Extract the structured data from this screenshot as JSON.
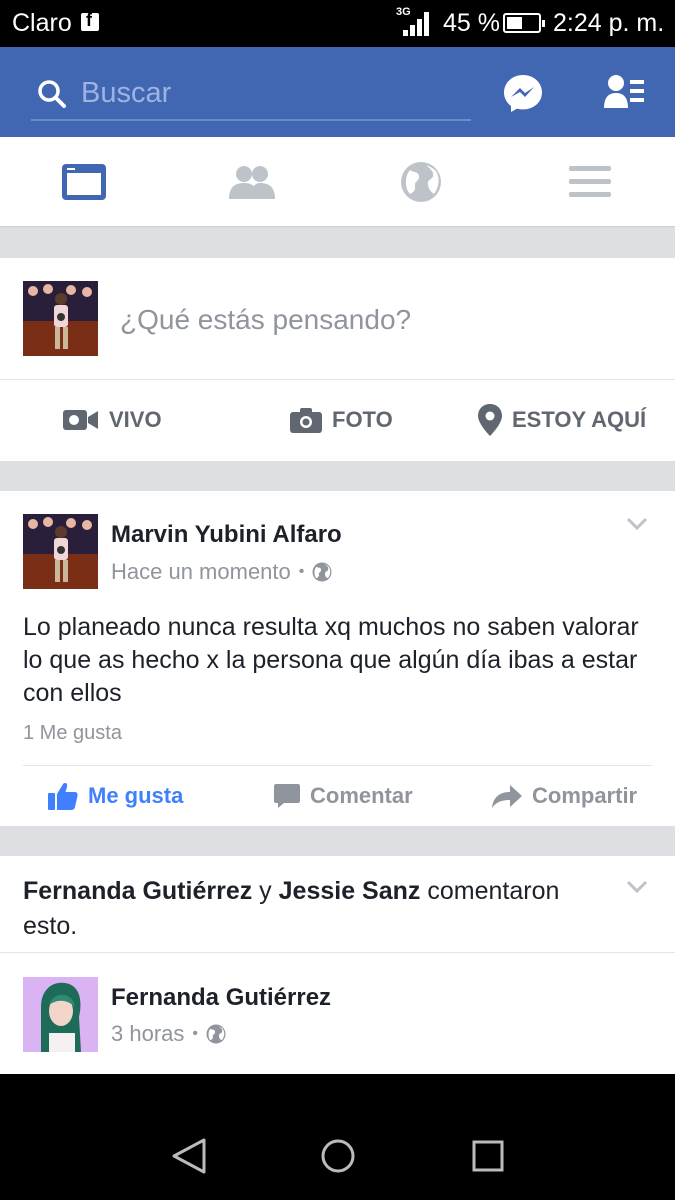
{
  "status_bar": {
    "carrier": "Claro",
    "network": "3G",
    "battery_percent": "45 %",
    "time": "2:24 p. m."
  },
  "topbar": {
    "search_placeholder": "Buscar",
    "icons": [
      "search-icon",
      "messenger-icon",
      "friend-requests-icon"
    ]
  },
  "nav_tabs": [
    {
      "name": "news-feed",
      "active": true
    },
    {
      "name": "friends",
      "active": false
    },
    {
      "name": "notifications-globe",
      "active": false
    },
    {
      "name": "menu",
      "active": false
    }
  ],
  "composer": {
    "prompt": "¿Qué estás pensando?",
    "actions": [
      "VIVO",
      "FOTO",
      "ESTOY AQUÍ"
    ]
  },
  "post": {
    "author": "Marvin Yubini Alfaro",
    "time": "Hace un momento",
    "privacy_separator": "•",
    "text": "Lo planeado  nunca resulta xq muchos  no saben valorar lo que as hecho x la persona que algún día ibas a estar con ellos",
    "likes": "1 Me gusta",
    "actions": {
      "like": "Me gusta",
      "comment": "Comentar",
      "share": "Compartir"
    }
  },
  "story": {
    "header_name1": "Fernanda Gutiérrez",
    "header_connector": " y ",
    "header_name2": "Jessie Sanz",
    "header_rest": " comentaron esto.",
    "author": "Fernanda Gutiérrez",
    "time": "3 horas",
    "privacy_separator": "•"
  },
  "colors": {
    "facebook_blue": "#4267b2",
    "like_blue": "#4080ff",
    "feed_gray": "#dddfe2",
    "text_dark": "#1d2129",
    "text_gray": "#90949c"
  }
}
